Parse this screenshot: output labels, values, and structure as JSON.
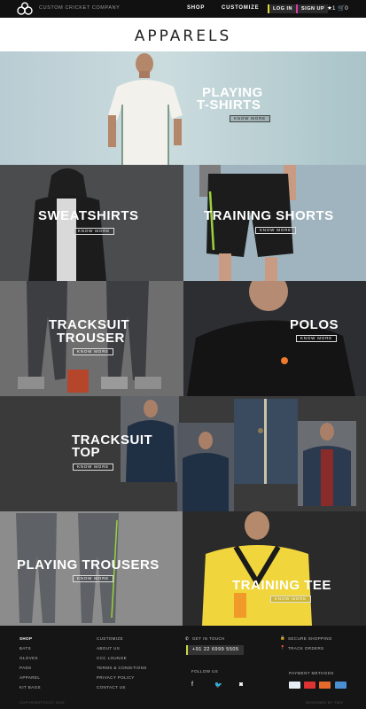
{
  "header": {
    "company": "CUSTOM CRICKET COMPANY",
    "nav": {
      "shop": "SHOP",
      "customize": "CUSTOMIZE"
    },
    "login": "LOG IN",
    "signup": "SIGN UP",
    "wishlist_count": "★1",
    "cart_count": "🛒0"
  },
  "page_title": "APPARELS",
  "know_more": "KNOW MORE",
  "tiles": {
    "playing_tshirts": {
      "line1": "PLAYING",
      "line2": "T-SHIRTS"
    },
    "sweatshirts": "SWEATSHIRTS",
    "training_shorts": "TRAINING SHORTS",
    "tracksuit_trouser": {
      "line1": "TRACKSUIT",
      "line2": "TROUSER"
    },
    "polos": "POLOS",
    "tracksuit_top": {
      "line1": "TRACKSUIT",
      "line2": "TOP"
    },
    "playing_trousers": "PLAYING TROUSERS",
    "training_tee": "TRAINING TEE"
  },
  "footer": {
    "shop_col": [
      "SHOP",
      "BATS",
      "GLOVES",
      "PADS",
      "APPAREL",
      "KIT BAGS"
    ],
    "info_col": [
      "CUSTOMIZE",
      "ABOUT US",
      "CCC LOUNGE",
      "TERMS & CONDITIONS",
      "PRIVACY POLICY",
      "CONTACT US"
    ],
    "get_in_touch": "GET IN TOUCH",
    "phone": "+91 22 6999 5505",
    "follow_us": "FOLLOW US",
    "secure_shopping": "SECURE SHOPPING",
    "track_orders": "TRACK ORDERS",
    "payment_methods": "PAYMENT METHODS",
    "copyright": "COPYRIGHT©CCC 2016",
    "designed_by": "DESIGNED BY TWO"
  },
  "colors": {
    "login_accent": "#e3d63b",
    "signup_accent": "#d63ca8",
    "phone_accent": "#c9d93c"
  },
  "icons": {
    "logo": "ccc-logo-icon",
    "facebook": "facebook-icon",
    "twitter": "twitter-icon",
    "instagram": "instagram-icon"
  }
}
